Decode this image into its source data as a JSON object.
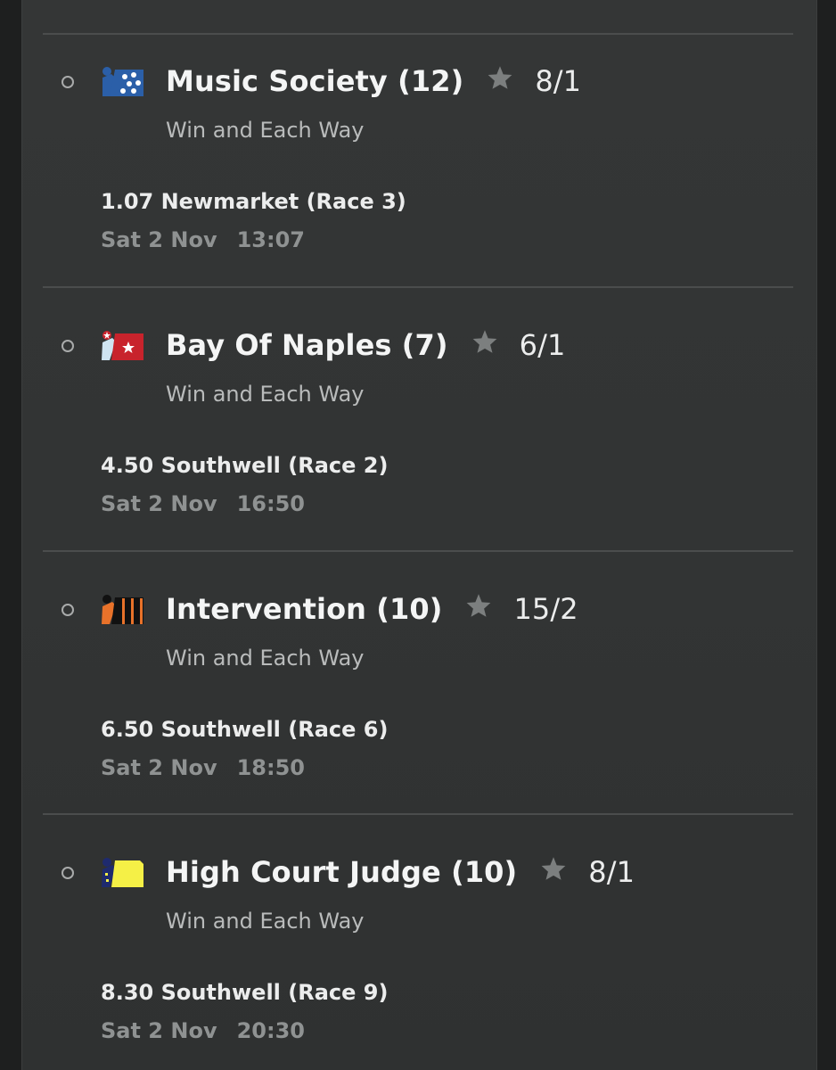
{
  "bets": [
    {
      "horse": "Music Society (12)",
      "odds": "8/1",
      "market": "Win and Each Way",
      "race": "1.07 Newmarket (Race 3)",
      "date": "Sat 2 Nov",
      "time": "13:07",
      "silks": {
        "type": "dots",
        "primary": "#2b5fa8",
        "secondary": "#ffffff"
      }
    },
    {
      "horse": "Bay Of Naples (7)",
      "odds": "6/1",
      "market": "Win and Each Way",
      "race": "4.50 Southwell (Race 2)",
      "date": "Sat 2 Nov",
      "time": "16:50",
      "silks": {
        "type": "star",
        "primary": "#c8232c",
        "secondary": "#ffffff"
      }
    },
    {
      "horse": "Intervention (10)",
      "odds": "15/2",
      "market": "Win and Each Way",
      "race": "6.50 Southwell (Race 6)",
      "date": "Sat 2 Nov",
      "time": "18:50",
      "silks": {
        "type": "stripes",
        "primary": "#111111",
        "secondary": "#e8722a"
      }
    },
    {
      "horse": "High Court Judge (10)",
      "odds": "8/1",
      "market": "Win and Each Way",
      "race": "8.30 Southwell (Race 9)",
      "date": "Sat 2 Nov",
      "time": "20:30",
      "silks": {
        "type": "plain",
        "primary": "#f5f046",
        "secondary": "#1e2a6e"
      }
    }
  ],
  "colors": {
    "background": "#333535",
    "divider": "#4b4d4d",
    "star": "#7c7f7f"
  },
  "icons": {
    "radio": "radio-unchecked-icon",
    "star": "star-icon"
  }
}
